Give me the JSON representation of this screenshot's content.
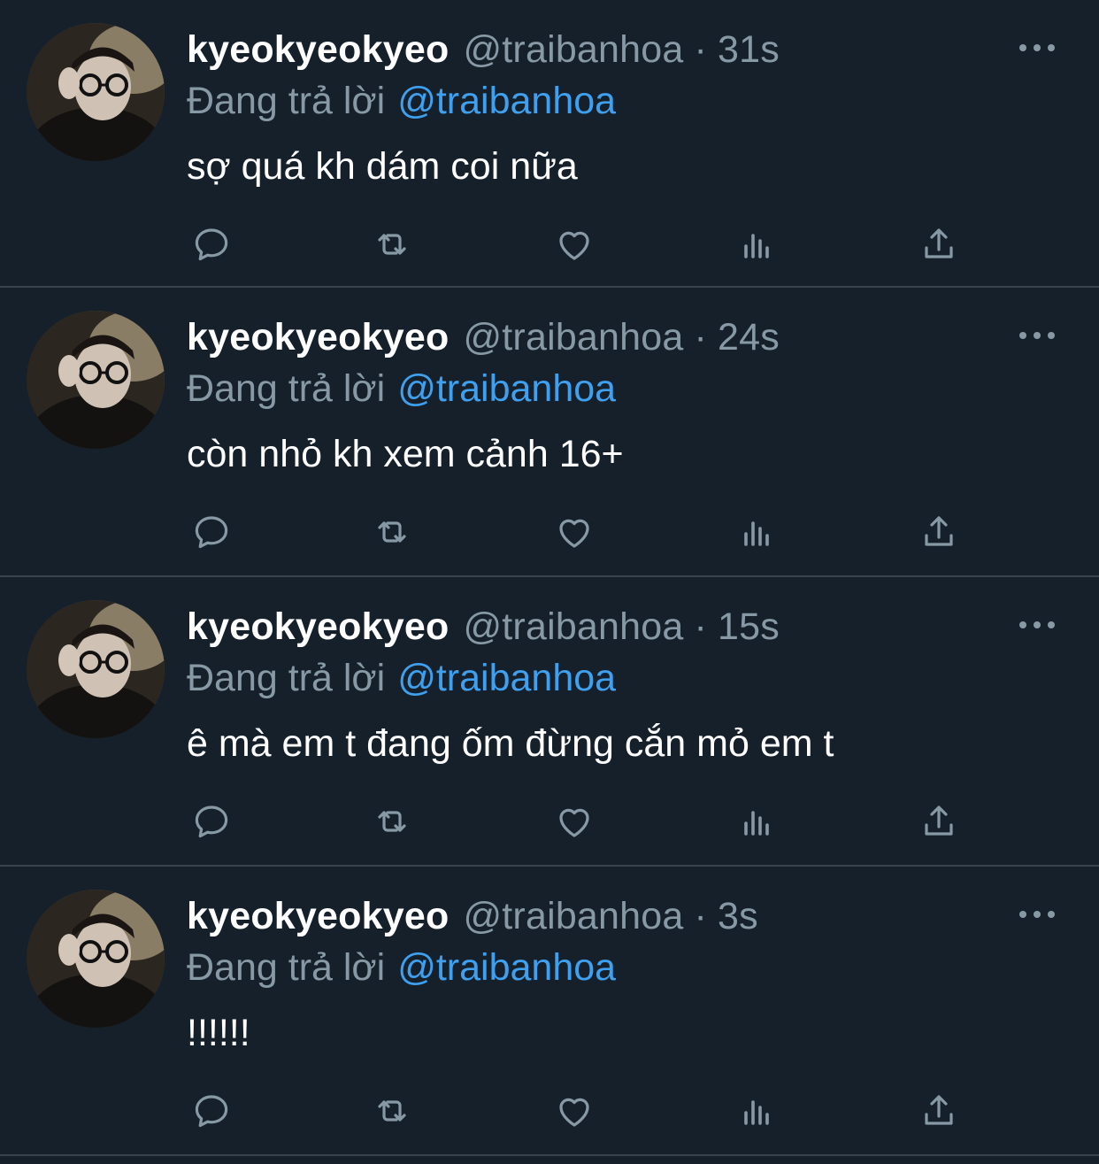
{
  "tweets": [
    {
      "display_name": "kyeokyeokyeo",
      "handle": "@traibanhoa",
      "separator": "·",
      "time": "31s",
      "reply_label": "Đang trả lời",
      "reply_to": "@traibanhoa",
      "text": "sợ quá kh dám coi nữa"
    },
    {
      "display_name": "kyeokyeokyeo",
      "handle": "@traibanhoa",
      "separator": "·",
      "time": "24s",
      "reply_label": "Đang trả lời",
      "reply_to": "@traibanhoa",
      "text": "còn nhỏ kh xem cảnh 16+"
    },
    {
      "display_name": "kyeokyeokyeo",
      "handle": "@traibanhoa",
      "separator": "·",
      "time": "15s",
      "reply_label": "Đang trả lời",
      "reply_to": "@traibanhoa",
      "text": "ê mà em t đang ốm đừng cắn mỏ em t"
    },
    {
      "display_name": "kyeokyeokyeo",
      "handle": "@traibanhoa",
      "separator": "·",
      "time": "3s",
      "reply_label": "Đang trả lời",
      "reply_to": "@traibanhoa",
      "text": "!!!!!!"
    }
  ],
  "icons": [
    "reply-icon",
    "retweet-icon",
    "like-icon",
    "analytics-icon",
    "share-icon",
    "more-icon"
  ],
  "colors": {
    "background": "#15202b",
    "divider": "#38444d",
    "secondary_text": "#8899a6",
    "mention": "#3ea0ee",
    "primary_text": "#ffffff"
  }
}
